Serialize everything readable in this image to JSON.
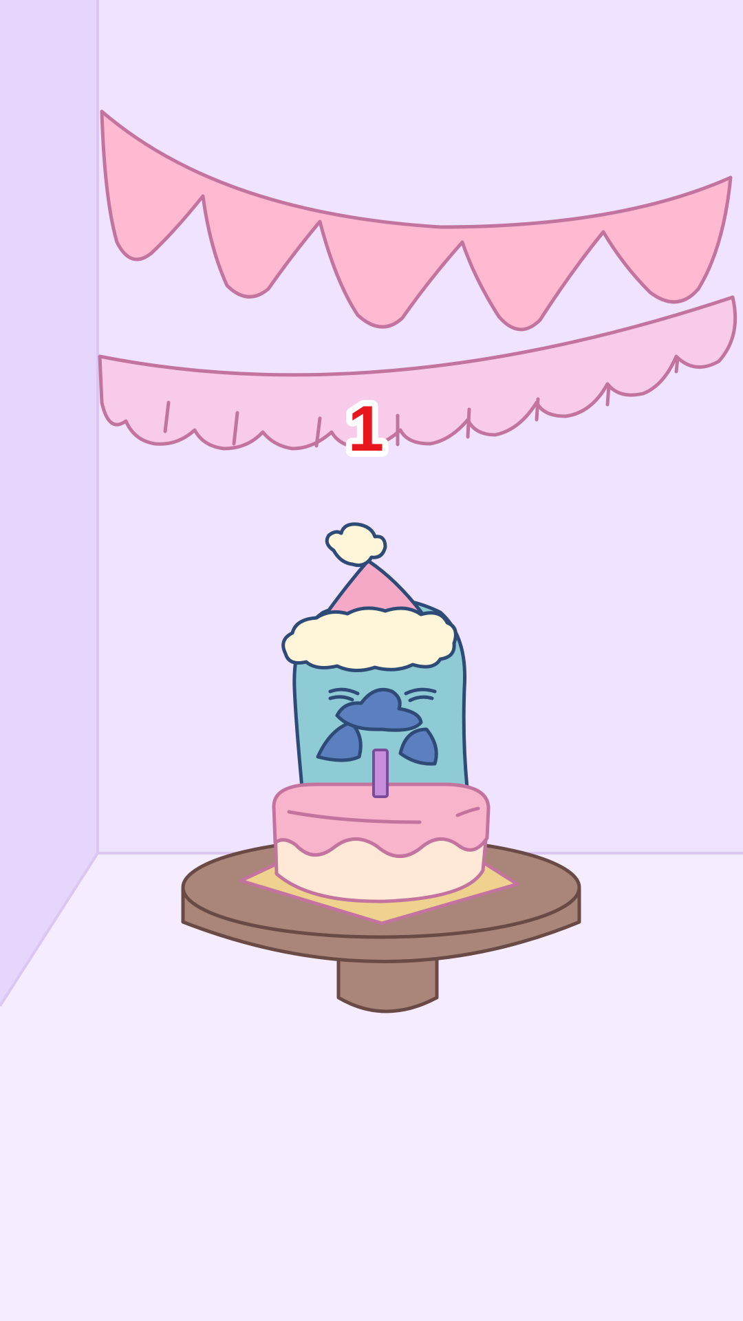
{
  "scene": {
    "number_label": "1",
    "colors": {
      "wall": "#efe3ff",
      "side_wall": "#e6d6fb",
      "floor": "#f5edff",
      "wall_edge": "#dcc6f3",
      "outline_pink": "#c2749f",
      "pennant_fill": "#ffb9d0",
      "scallop_fill": "#f9cbeb",
      "number_red": "#e8171d",
      "body_teal": "#8fcbd4",
      "outline_navy": "#2e4a77",
      "beak_blue": "#5c7fbf",
      "hat_pink": "#f5a9c6",
      "hat_trim": "#fff5d9",
      "table_brown": "#a9857a",
      "table_outline": "#6a4a44",
      "cake_top": "#f8b4ca",
      "cake_base": "#ffe9d6",
      "plate": "#f0d28f",
      "candle": "#c78ede"
    },
    "icons": [
      "pennant-banner",
      "scallop-banner",
      "penguin-character",
      "party-hat",
      "birthday-cake",
      "candle",
      "round-table"
    ]
  }
}
